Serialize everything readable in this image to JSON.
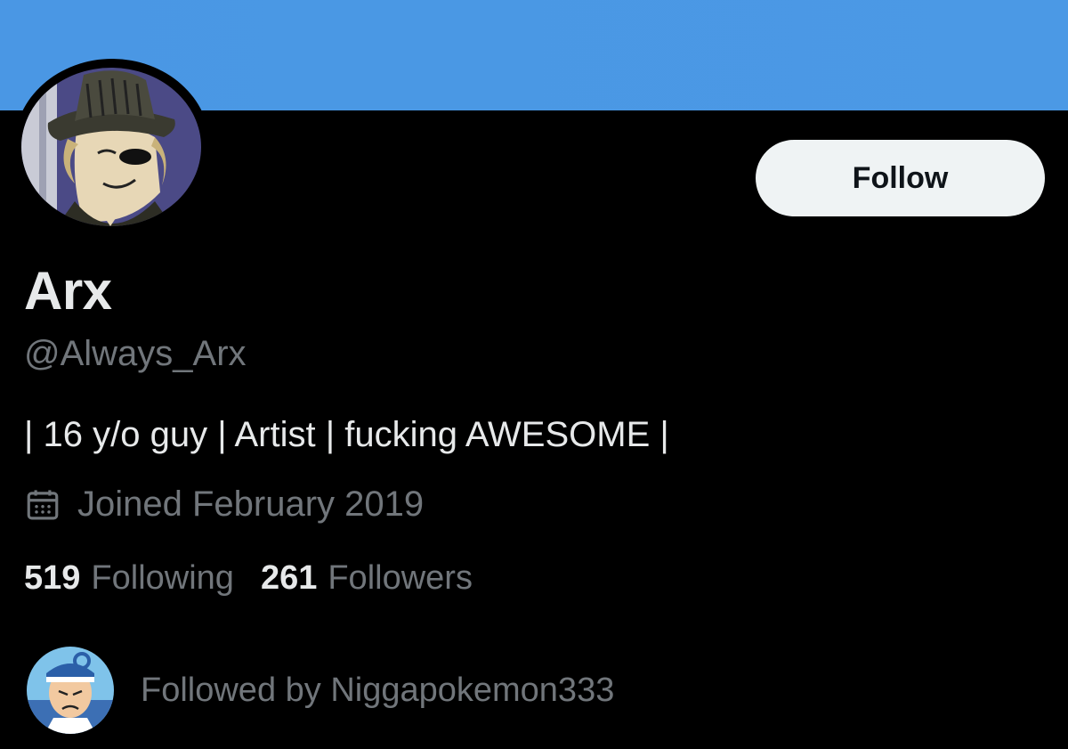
{
  "colors": {
    "banner": "#4a97e4",
    "background": "#000000",
    "primary_text": "#e7e9ea",
    "secondary_text": "#71767b",
    "button_bg": "#eff3f4",
    "button_text": "#0f1419"
  },
  "header": {
    "banner_icon": "profile-banner"
  },
  "profile": {
    "avatar_icon": "profile-avatar",
    "display_name": "Arx",
    "handle": "@Always_Arx",
    "bio": "| 16 y/o guy | Artist | fucking AWESOME |",
    "joined_icon": "calendar-icon",
    "joined": "Joined February 2019"
  },
  "actions": {
    "follow_label": "Follow"
  },
  "stats": {
    "following_count": "519",
    "following_label": "Following",
    "followers_count": "261",
    "followers_label": "Followers"
  },
  "followed_by": {
    "avatar_icon": "follower-avatar",
    "text": "Followed by Niggapokemon333"
  }
}
